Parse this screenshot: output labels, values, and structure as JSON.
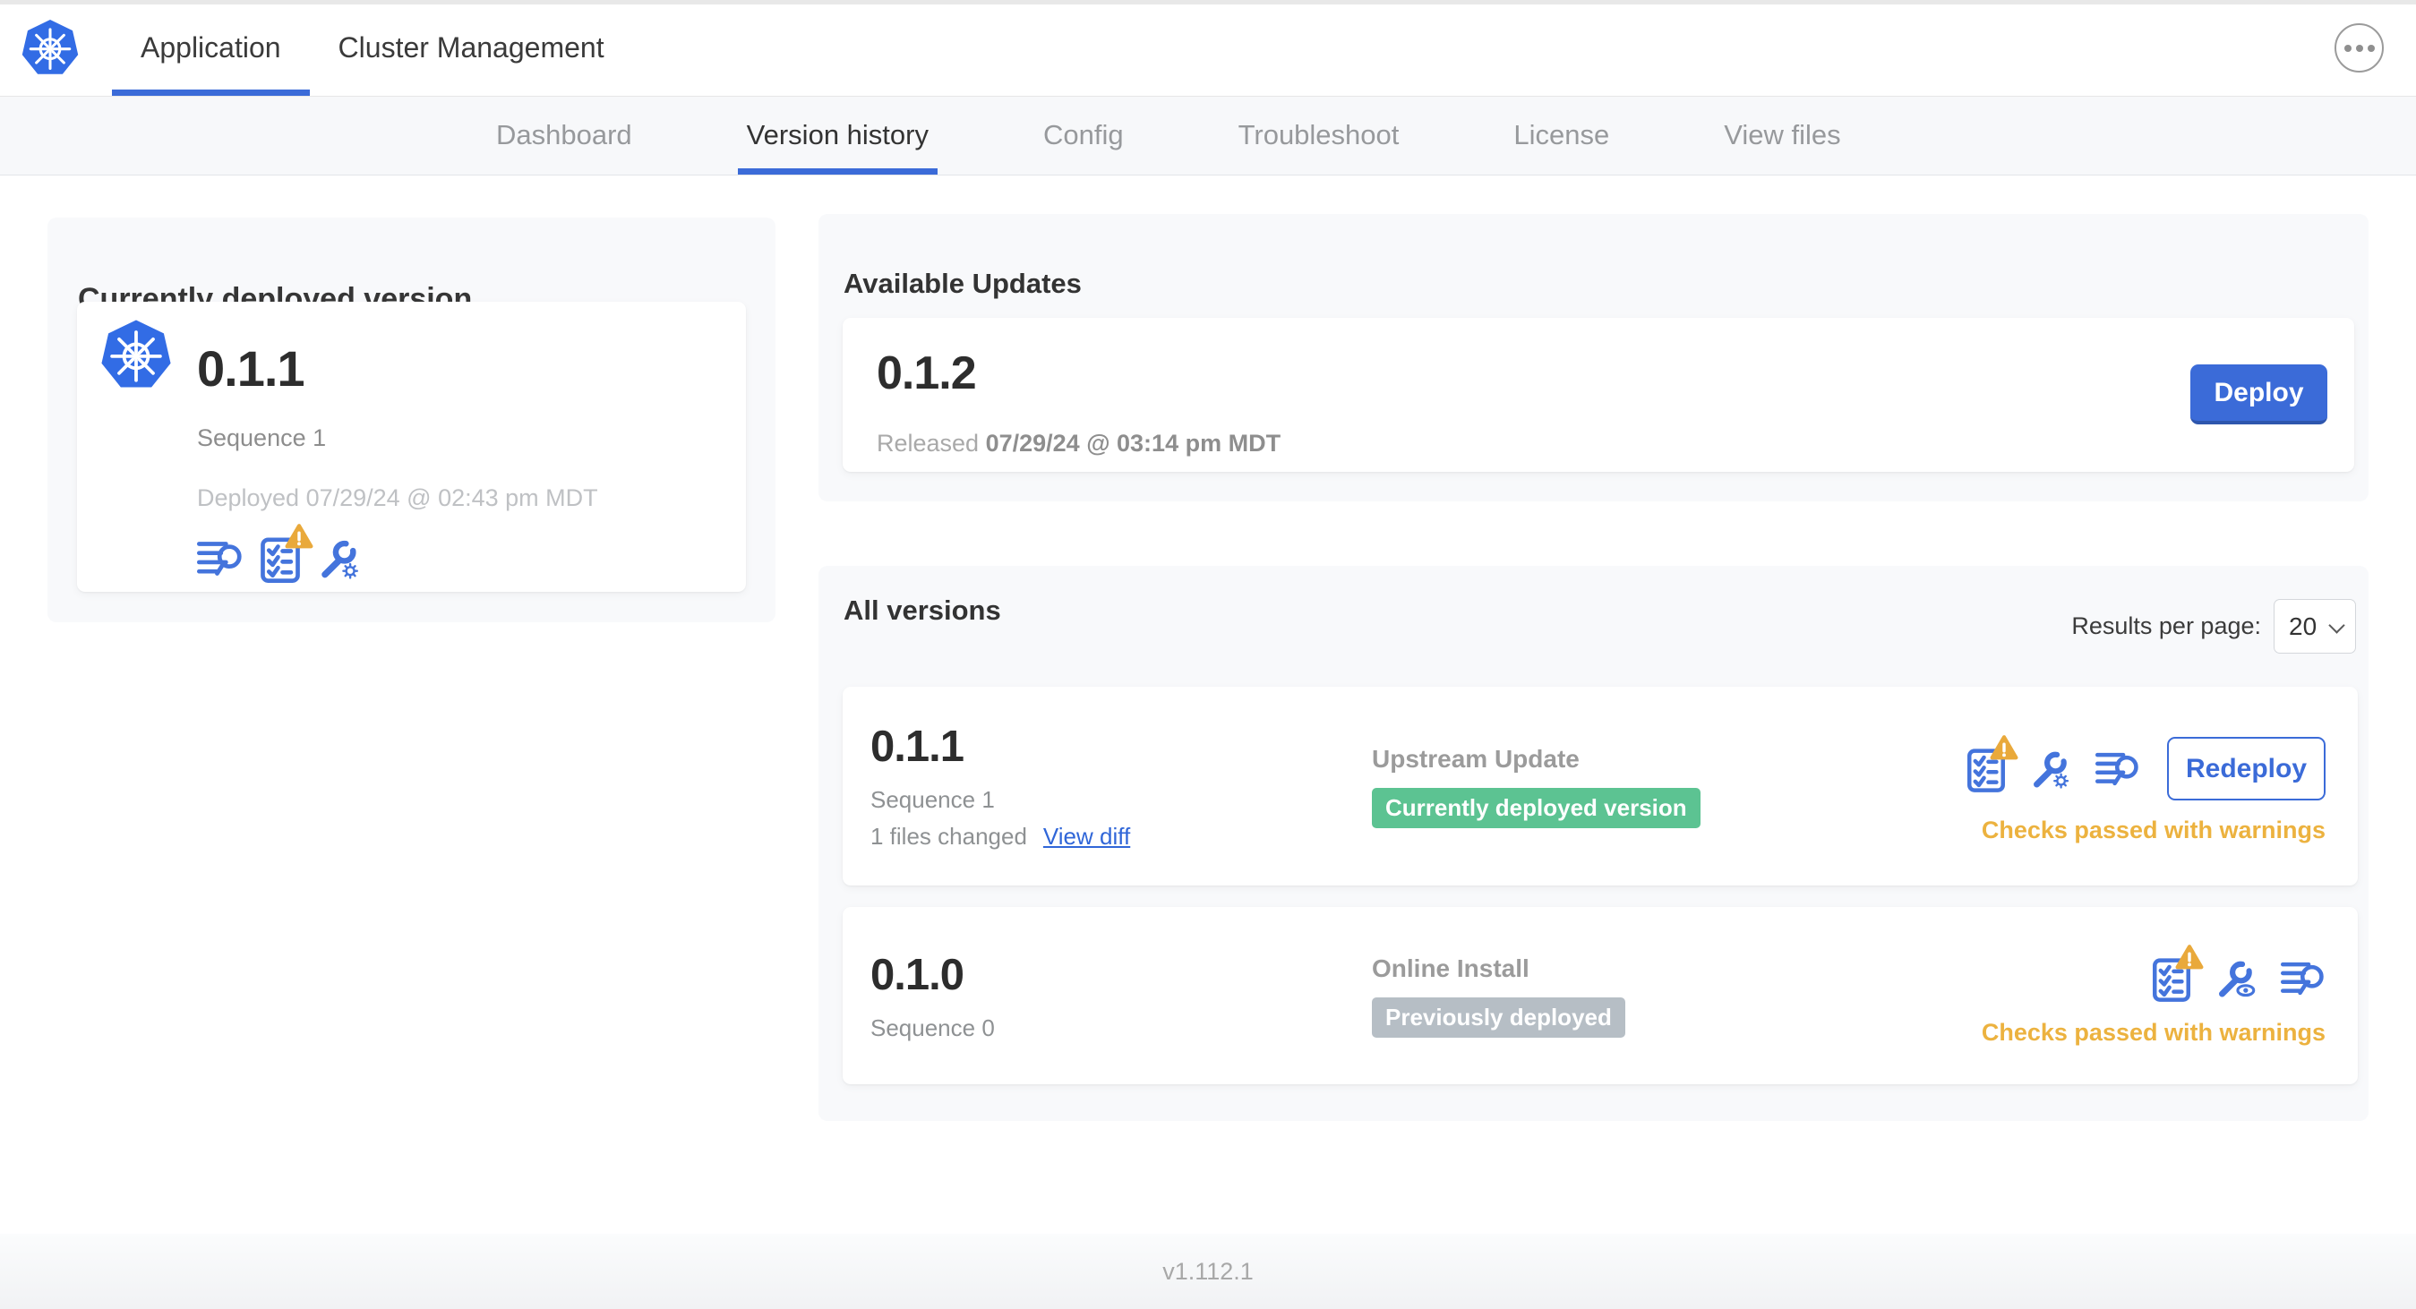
{
  "header": {
    "logo": "kubernetes-logo",
    "tabs": [
      {
        "label": "Application",
        "active": true
      },
      {
        "label": "Cluster Management",
        "active": false
      }
    ],
    "menu_icon": "ellipsis-icon"
  },
  "subnav": {
    "tabs": [
      "Dashboard",
      "Version history",
      "Config",
      "Troubleshoot",
      "License",
      "View files"
    ],
    "active": "Version history"
  },
  "current": {
    "title": "Currently deployed version",
    "version": "0.1.1",
    "sequence": "Sequence 1",
    "deployed": "Deployed 07/29/24 @ 02:43 pm MDT",
    "icons": [
      "logs-icon",
      "preflight-checks-warning-icon",
      "wrench-gear-icon"
    ]
  },
  "updates": {
    "title": "Available Updates",
    "version": "0.1.2",
    "released_prefix": "Released",
    "released_datetime": "07/29/24 @ 03:14 pm MDT",
    "deploy_label": "Deploy"
  },
  "versions": {
    "title": "All versions",
    "results_per_page_label": "Results per page:",
    "results_per_page_value": "20",
    "rows": [
      {
        "version": "0.1.1",
        "sequence": "Sequence 1",
        "files_changed": "1 files changed",
        "view_diff_label": "View diff",
        "source": "Upstream Update",
        "badge_label": "Currently deployed version",
        "badge_color": "green",
        "icons": [
          "preflight-checks-warning-icon",
          "wrench-gear-icon",
          "logs-icon"
        ],
        "action_label": "Redeploy",
        "status": "Checks passed with warnings"
      },
      {
        "version": "0.1.0",
        "sequence": "Sequence 0",
        "source": "Online Install",
        "badge_label": "Previously deployed",
        "badge_color": "gray",
        "icons": [
          "preflight-checks-warning-icon",
          "wrench-eye-icon",
          "logs-icon"
        ],
        "status": "Checks passed with warnings"
      }
    ]
  },
  "footer": {
    "version": "v1.112.1"
  },
  "colors": {
    "accent_blue": "#3b6bd8",
    "link_blue": "#3066d8",
    "icon_blue": "#4474dc",
    "logo_blue": "#326ce5",
    "warning_amber": "#e9a93b",
    "status_orange": "#ecb23f",
    "badge_green": "#5cc392",
    "badge_gray": "#b6bec5"
  }
}
